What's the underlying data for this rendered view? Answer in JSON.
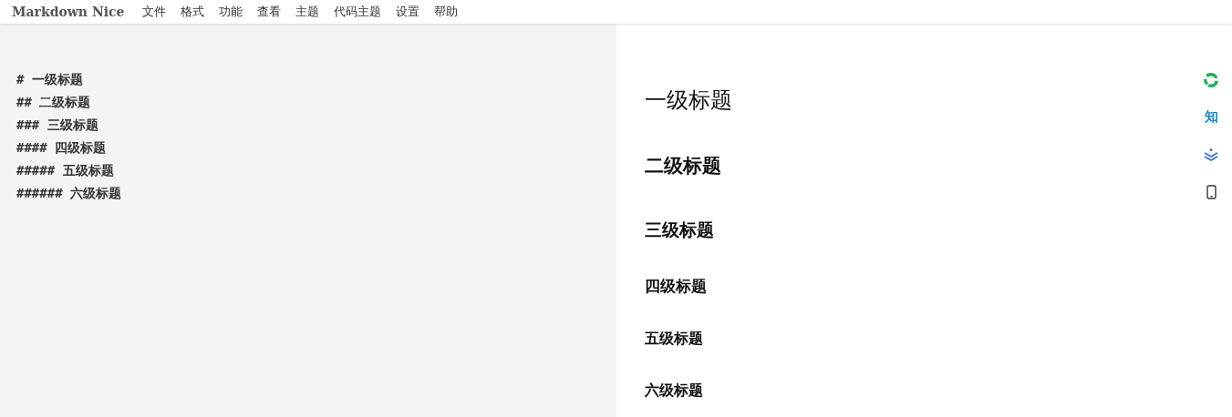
{
  "menu_bar": {
    "brand": "Markdown Nice",
    "items": [
      "文件",
      "格式",
      "功能",
      "查看",
      "主题",
      "代码主题",
      "设置",
      "帮助"
    ]
  },
  "editor": {
    "lines": [
      "# 一级标题",
      "## 二级标题",
      "### 三级标题",
      "#### 四级标题",
      "##### 五级标题",
      "###### 六级标题"
    ]
  },
  "preview": {
    "headings": [
      {
        "kind": "h1",
        "text": "一级标题"
      },
      {
        "kind": "h2",
        "text": "二级标题"
      },
      {
        "kind": "h3",
        "text": "三级标题"
      },
      {
        "kind": "h4",
        "text": "四级标题"
      },
      {
        "kind": "h5",
        "text": "五级标题"
      },
      {
        "kind": "h6",
        "text": "六级标题"
      }
    ]
  },
  "side_toolbar": [
    {
      "kind": "icon"
    },
    {
      "kind": "text",
      "text": "知"
    },
    {
      "kind": "icon"
    },
    {
      "kind": "icon"
    }
  ]
}
